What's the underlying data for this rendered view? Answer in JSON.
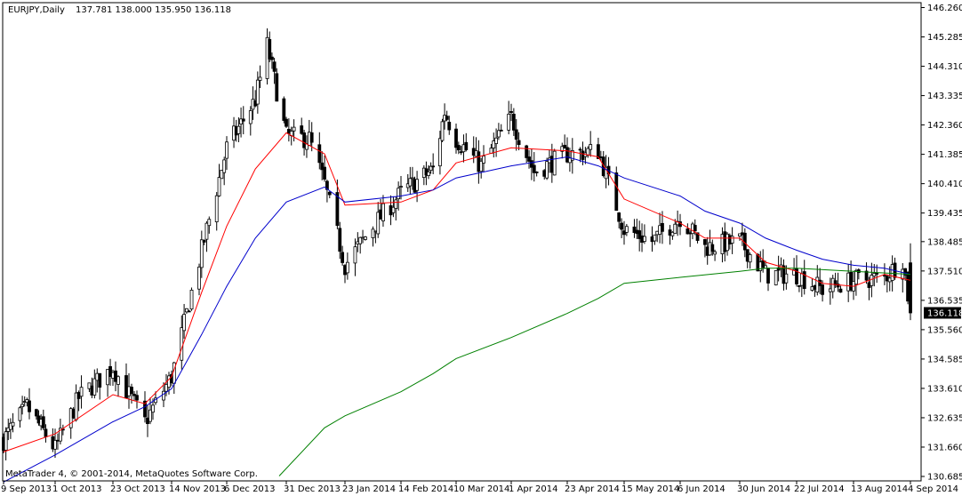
{
  "header": {
    "symbol": "EURJPY,Daily",
    "ohlc": "137.781 138.000 135.950 136.118"
  },
  "footer": {
    "copyright": "MetaTrader 4, © 2001-2014, MetaQuotes Software Corp."
  },
  "chart_data": {
    "type": "candlestick",
    "symbol": "EURJPY",
    "timeframe": "Daily",
    "current_price_label": "136.118",
    "ylim": [
      130.6,
      146.4
    ],
    "y_ticks": [
      "146.260",
      "145.285",
      "144.310",
      "143.335",
      "142.360",
      "141.385",
      "140.410",
      "139.435",
      "138.485",
      "137.510",
      "136.535",
      "135.560",
      "134.585",
      "133.610",
      "132.635",
      "131.660",
      "130.685"
    ],
    "x_ticks": [
      "9 Sep 2013",
      "1 Oct 2013",
      "23 Oct 2013",
      "14 Nov 2013",
      "6 Dec 2013",
      "31 Dec 2013",
      "23 Jan 2014",
      "14 Feb 2014",
      "10 Mar 2014",
      "1 Apr 2014",
      "23 Apr 2014",
      "15 May 2014",
      "6 Jun 2014",
      "30 Jun 2014",
      "22 Jul 2014",
      "13 Aug 2014",
      "4 Sep 2014"
    ],
    "close_path": [
      [
        "9 Sep 2013",
        131.9
      ],
      [
        "19 Sep 2013",
        133.0
      ],
      [
        "1 Oct 2013",
        131.6
      ],
      [
        "10 Oct 2013",
        133.3
      ],
      [
        "23 Oct 2013",
        134.3
      ],
      [
        "4 Nov 2013",
        132.5
      ],
      [
        "14 Nov 2013",
        134.0
      ],
      [
        "26 Nov 2013",
        138.2
      ],
      [
        "6 Dec 2013",
        141.6
      ],
      [
        "18 Dec 2013",
        143.2
      ],
      [
        "23 Dec 2013",
        145.0
      ],
      [
        "31 Dec 2013",
        142.0
      ],
      [
        "9 Jan 2014",
        141.9
      ],
      [
        "15 Jan 2014",
        140.4
      ],
      [
        "23 Jan 2014",
        137.7
      ],
      [
        "3 Feb 2014",
        139.0
      ],
      [
        "14 Feb 2014",
        140.1
      ],
      [
        "28 Feb 2014",
        140.9
      ],
      [
        "5 Mar 2014",
        142.8
      ],
      [
        "10 Mar 2014",
        141.9
      ],
      [
        "20 Mar 2014",
        141.0
      ],
      [
        "1 Apr 2014",
        142.6
      ],
      [
        "10 Apr 2014",
        140.8
      ],
      [
        "23 Apr 2014",
        141.4
      ],
      [
        "5 May 2014",
        141.5
      ],
      [
        "15 May 2014",
        138.9
      ],
      [
        "26 May 2014",
        138.5
      ],
      [
        "6 Jun 2014",
        139.3
      ],
      [
        "16 Jun 2014",
        138.3
      ],
      [
        "30 Jun 2014",
        138.5
      ],
      [
        "10 Jul 2014",
        137.4
      ],
      [
        "22 Jul 2014",
        137.4
      ],
      [
        "1 Aug 2014",
        136.9
      ],
      [
        "13 Aug 2014",
        137.2
      ],
      [
        "25 Aug 2014",
        137.3
      ],
      [
        "1 Sep 2014",
        137.9
      ],
      [
        "4 Sep 2014",
        136.118
      ]
    ],
    "series": [
      {
        "name": "",
        "kind": "moving-average",
        "color": "#ff0000",
        "points": [
          [
            "9 Sep 2013",
            131.5
          ],
          [
            "1 Oct 2013",
            132.1
          ],
          [
            "23 Oct 2013",
            133.4
          ],
          [
            "4 Nov 2013",
            133.1
          ],
          [
            "14 Nov 2013",
            134.0
          ],
          [
            "26 Nov 2013",
            136.8
          ],
          [
            "6 Dec 2013",
            139.0
          ],
          [
            "18 Dec 2013",
            140.9
          ],
          [
            "31 Dec 2013",
            142.1
          ],
          [
            "15 Jan 2014",
            141.4
          ],
          [
            "23 Jan 2014",
            139.7
          ],
          [
            "14 Feb 2014",
            139.8
          ],
          [
            "28 Feb 2014",
            140.2
          ],
          [
            "10 Mar 2014",
            141.1
          ],
          [
            "1 Apr 2014",
            141.6
          ],
          [
            "23 Apr 2014",
            141.5
          ],
          [
            "5 May 2014",
            141.3
          ],
          [
            "15 May 2014",
            139.9
          ],
          [
            "6 Jun 2014",
            139.1
          ],
          [
            "16 Jun 2014",
            138.6
          ],
          [
            "30 Jun 2014",
            138.6
          ],
          [
            "10 Jul 2014",
            137.8
          ],
          [
            "22 Jul 2014",
            137.5
          ],
          [
            "1 Aug 2014",
            137.1
          ],
          [
            "13 Aug 2014",
            137.0
          ],
          [
            "25 Aug 2014",
            137.4
          ],
          [
            "4 Sep 2014",
            137.2
          ]
        ]
      },
      {
        "name": "",
        "kind": "moving-average",
        "color": "#0000cc",
        "points": [
          [
            "9 Sep 2013",
            130.5
          ],
          [
            "1 Oct 2013",
            131.4
          ],
          [
            "23 Oct 2013",
            132.5
          ],
          [
            "4 Nov 2013",
            133.0
          ],
          [
            "14 Nov 2013",
            133.6
          ],
          [
            "26 Nov 2013",
            135.4
          ],
          [
            "6 Dec 2013",
            137.0
          ],
          [
            "18 Dec 2013",
            138.6
          ],
          [
            "31 Dec 2013",
            139.8
          ],
          [
            "15 Jan 2014",
            140.3
          ],
          [
            "23 Jan 2014",
            139.8
          ],
          [
            "14 Feb 2014",
            140.0
          ],
          [
            "28 Feb 2014",
            140.2
          ],
          [
            "10 Mar 2014",
            140.6
          ],
          [
            "1 Apr 2014",
            141.0
          ],
          [
            "23 Apr 2014",
            141.3
          ],
          [
            "5 May 2014",
            141.0
          ],
          [
            "15 May 2014",
            140.6
          ],
          [
            "6 Jun 2014",
            140.0
          ],
          [
            "16 Jun 2014",
            139.5
          ],
          [
            "30 Jun 2014",
            139.1
          ],
          [
            "10 Jul 2014",
            138.6
          ],
          [
            "22 Jul 2014",
            138.2
          ],
          [
            "1 Aug 2014",
            137.9
          ],
          [
            "13 Aug 2014",
            137.7
          ],
          [
            "25 Aug 2014",
            137.6
          ],
          [
            "4 Sep 2014",
            137.4
          ]
        ]
      },
      {
        "name": "",
        "kind": "moving-average",
        "color": "#008000",
        "points": [
          [
            "28 Dec 2013",
            130.7
          ],
          [
            "15 Jan 2014",
            132.3
          ],
          [
            "23 Jan 2014",
            132.7
          ],
          [
            "14 Feb 2014",
            133.5
          ],
          [
            "28 Feb 2014",
            134.1
          ],
          [
            "10 Mar 2014",
            134.6
          ],
          [
            "1 Apr 2014",
            135.3
          ],
          [
            "23 Apr 2014",
            136.1
          ],
          [
            "5 May 2014",
            136.6
          ],
          [
            "15 May 2014",
            137.1
          ],
          [
            "6 Jun 2014",
            137.3
          ],
          [
            "30 Jun 2014",
            137.5
          ],
          [
            "10 Jul 2014",
            137.6
          ],
          [
            "22 Jul 2014",
            137.6
          ],
          [
            "13 Aug 2014",
            137.5
          ],
          [
            "4 Sep 2014",
            137.4
          ]
        ]
      }
    ],
    "grid": false,
    "legend": "none"
  }
}
